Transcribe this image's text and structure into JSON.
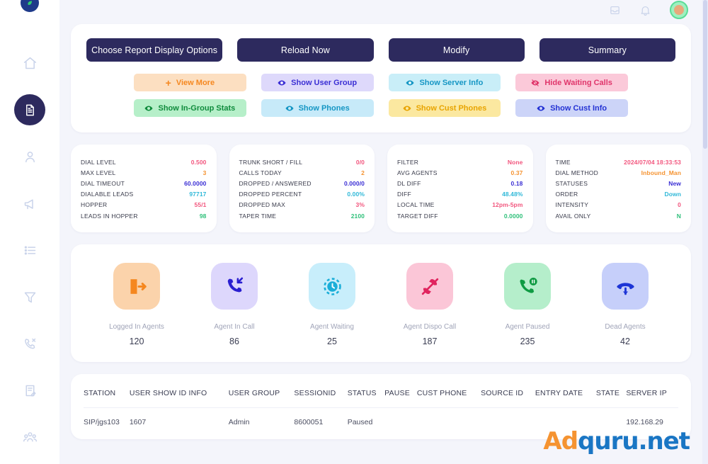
{
  "sidebar": {
    "logo": "leaf-badge-logo",
    "items": [
      {
        "name": "home",
        "icon": "home-icon",
        "active": false
      },
      {
        "name": "reports",
        "icon": "document-report-icon",
        "active": true
      },
      {
        "name": "users",
        "icon": "user-icon",
        "active": false
      },
      {
        "name": "campaigns",
        "icon": "megaphone-icon",
        "active": false
      },
      {
        "name": "lists",
        "icon": "list-icon",
        "active": false
      },
      {
        "name": "filters",
        "icon": "funnel-icon",
        "active": false
      },
      {
        "name": "calls",
        "icon": "phone-call-icon",
        "active": false
      },
      {
        "name": "scripts",
        "icon": "clipboard-edit-icon",
        "active": false
      },
      {
        "name": "groups",
        "icon": "team-group-icon",
        "active": false
      }
    ]
  },
  "topbar": {
    "icons": [
      "inbox-icon",
      "bell-icon"
    ],
    "avatar": "user-avatar"
  },
  "toolbar": {
    "primary_buttons": [
      {
        "label": "Choose Report Display Options",
        "name": "choose-report-display-options-button"
      },
      {
        "label": "Reload Now",
        "name": "reload-now-button"
      },
      {
        "label": "Modify",
        "name": "modify-button"
      },
      {
        "label": "Summary",
        "name": "summary-button"
      }
    ],
    "toggle_pills": [
      {
        "label": "View More",
        "icon": "plus-icon",
        "bg": "#fcdfc1",
        "fg": "#f5871f",
        "name": "view-more-pill"
      },
      {
        "label": "Show User Group",
        "icon": "eye-icon",
        "bg": "#ded9fb",
        "fg": "#3b2fd4",
        "name": "show-user-group-pill"
      },
      {
        "label": "Show Server Info",
        "icon": "eye-icon",
        "bg": "#c9eef8",
        "fg": "#1596c4",
        "name": "show-server-info-pill"
      },
      {
        "label": "Hide Waiting Calls",
        "icon": "eye-off-icon",
        "bg": "#fbc9d9",
        "fg": "#e0356b",
        "name": "hide-waiting-calls-pill"
      },
      {
        "label": "Show In-Group Stats",
        "icon": "eye-icon",
        "bg": "#b6efc9",
        "fg": "#0f8b3c",
        "name": "show-in-group-stats-pill"
      },
      {
        "label": "Show Phones",
        "icon": "eye-icon",
        "bg": "#c7eaf9",
        "fg": "#1596c4",
        "name": "show-phones-pill"
      },
      {
        "label": "Show Cust Phones",
        "icon": "eye-icon",
        "bg": "#fbe8a0",
        "fg": "#e8a400",
        "name": "show-cust-phones-pill"
      },
      {
        "label": "Show Cust Info",
        "icon": "eye-icon",
        "bg": "#ccd4f8",
        "fg": "#2433d4",
        "name": "show-cust-info-pill"
      }
    ]
  },
  "stat_panels": [
    {
      "name": "dial-stats-panel",
      "rows": [
        {
          "label": "DIAL LEVEL",
          "value": "0.500",
          "color": "#f2567e"
        },
        {
          "label": "MAX LEVEL",
          "value": "3",
          "color": "#f59331"
        },
        {
          "label": "DIAL TIMEOUT",
          "value": "60.0000",
          "color": "#3b2fd4"
        },
        {
          "label": "DIALABLE LEADS",
          "value": "97717",
          "color": "#2fb8d8"
        },
        {
          "label": "HOPPER",
          "value": "55/1",
          "color": "#f2567e"
        },
        {
          "label": "LEADS IN HOPPER",
          "value": "98",
          "color": "#2fc07a"
        }
      ]
    },
    {
      "name": "trunk-stats-panel",
      "rows": [
        {
          "label": "TRUNK SHORT / FILL",
          "value": "0/0",
          "color": "#f2567e"
        },
        {
          "label": "CALLS TODAY",
          "value": "2",
          "color": "#f59331"
        },
        {
          "label": "DROPPED / ANSWERED",
          "value": "0.000/0",
          "color": "#3b2fd4"
        },
        {
          "label": "DROPPED PERCENT",
          "value": "0.00%",
          "color": "#2fb8d8"
        },
        {
          "label": "DROPPED MAX",
          "value": "3%",
          "color": "#f2567e"
        },
        {
          "label": "TAPER TIME",
          "value": "2100",
          "color": "#2fc07a"
        }
      ]
    },
    {
      "name": "filter-stats-panel",
      "rows": [
        {
          "label": "FILTER",
          "value": "None",
          "color": "#f2567e"
        },
        {
          "label": "AVG AGENTS",
          "value": "0.37",
          "color": "#f59331"
        },
        {
          "label": "DL DIFF",
          "value": "0.18",
          "color": "#3b2fd4"
        },
        {
          "label": "DIFF",
          "value": "48.48%",
          "color": "#2fb8d8"
        },
        {
          "label": "LOCAL TIME",
          "value": "12pm-5pm",
          "color": "#f2567e"
        },
        {
          "label": "TARGET DIFF",
          "value": "0.0000",
          "color": "#2fc07a"
        }
      ]
    },
    {
      "name": "session-stats-panel",
      "rows": [
        {
          "label": "TIME",
          "value": "2024/07/04 18:33:53",
          "color": "#f2567e"
        },
        {
          "label": "DIAL METHOD",
          "value": "Inbound_Man",
          "color": "#f59331"
        },
        {
          "label": "STATUSES",
          "value": "New",
          "color": "#3b2fd4"
        },
        {
          "label": "ORDER",
          "value": "Down",
          "color": "#2fb8d8"
        },
        {
          "label": "INTENSITY",
          "value": "0",
          "color": "#f2567e"
        },
        {
          "label": "AVAIL ONLY",
          "value": "N",
          "color": "#2fc07a"
        }
      ]
    }
  ],
  "metrics": [
    {
      "label": "Logged In Agents",
      "value": "120",
      "icon": "logout-door-icon",
      "bg": "#fbd3ab",
      "fg": "#f5871f",
      "name": "metric-logged-in-agents"
    },
    {
      "label": "Agent In Call",
      "value": "86",
      "icon": "phone-incoming-icon",
      "bg": "#ddd7fc",
      "fg": "#2a1fd0",
      "name": "metric-agent-in-call"
    },
    {
      "label": "Agent Waiting",
      "value": "25",
      "icon": "clock-waiting-icon",
      "bg": "#c8eefb",
      "fg": "#1aaed8",
      "name": "metric-agent-waiting"
    },
    {
      "label": "Agent Dispo Call",
      "value": "187",
      "icon": "phone-missed-icon",
      "bg": "#fbc6d7",
      "fg": "#e0245e",
      "name": "metric-agent-dispo-call"
    },
    {
      "label": "Agent Paused",
      "value": "235",
      "icon": "phone-pause-icon",
      "bg": "#b5eecb",
      "fg": "#0f9b43",
      "name": "metric-agent-paused"
    },
    {
      "label": "Dead Agents",
      "value": "42",
      "icon": "phone-down-icon",
      "bg": "#c6cffa",
      "fg": "#1d35d6",
      "name": "metric-dead-agents"
    }
  ],
  "table": {
    "columns": [
      "STATION",
      "USER SHOW ID INFO",
      "USER GROUP",
      "SESSIONID",
      "STATUS",
      "PAUSE",
      "CUST PHONE",
      "SOURCE ID",
      "ENTRY DATE",
      "STATE",
      "SERVER IP"
    ],
    "rows": [
      {
        "STATION": "SIP/jgs103",
        "USER SHOW ID INFO": "1607",
        "USER GROUP": "Admin",
        "SESSIONID": "8600051",
        "STATUS": "Paused",
        "PAUSE": "",
        "CUST PHONE": "",
        "SOURCE ID": "",
        "ENTRY DATE": "",
        "STATE": "",
        "SERVER IP": "192.168.29"
      }
    ]
  },
  "watermark": {
    "part_a": "Ad",
    "part_b": "quru.net"
  }
}
